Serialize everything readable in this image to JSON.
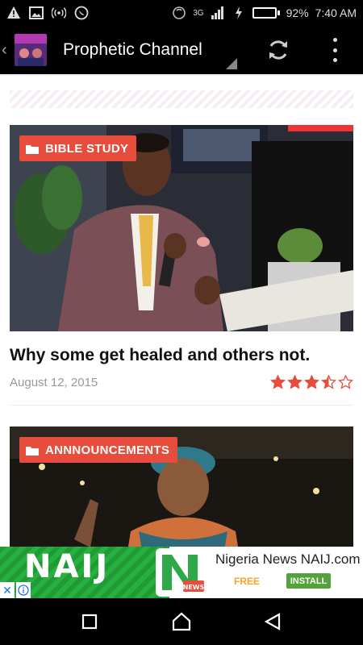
{
  "status_bar": {
    "network": "3G",
    "battery_percent": "92%",
    "battery_level": 0.92,
    "time": "7:40 AM",
    "battery_color": "#3ec74a"
  },
  "app_bar": {
    "title": "Prophetic Channel",
    "logo_text": "Prophetic Channel",
    "refresh_icon": "refresh-icon",
    "overflow_icon": "overflow-menu-icon"
  },
  "posts": [
    {
      "category": "BIBLE STUDY",
      "title": "Why some get healed and others not.",
      "date": "August 12, 2015",
      "rating": 3.5,
      "rating_max": 5,
      "accent": "#e74c3c"
    },
    {
      "category": "ANNNOUNCEMENTS",
      "accent": "#e74c3c"
    }
  ],
  "ad": {
    "brand": "NAIJ",
    "title": "Nigeria News NAIJ.com",
    "free_label": "FREE",
    "install_label": "INSTALL",
    "close_glyph": "✕",
    "logo_badge": "NEWS",
    "brand_color": "#27b040"
  }
}
